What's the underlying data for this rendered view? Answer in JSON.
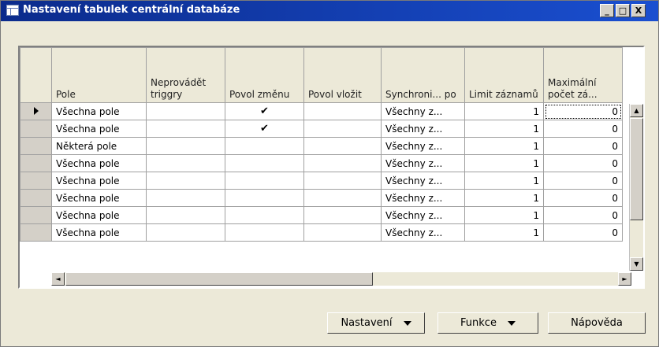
{
  "window": {
    "title": "Nastavení tabulek centrální databáze",
    "minimize": "_",
    "maximize": "□",
    "close": "X"
  },
  "grid": {
    "headers": [
      "Pole",
      "Neprovádět triggry",
      "Povol změnu",
      "Povol vložit",
      "Synchroni... po",
      "Limit záznamů",
      "Maximální počet zá..."
    ],
    "rows": [
      {
        "pole": "Všechna pole",
        "triggry": "",
        "zmenu": "✔",
        "vlozit": "",
        "sync": "Všechny z...",
        "limit": "1",
        "max": "0"
      },
      {
        "pole": "Všechna pole",
        "triggry": "",
        "zmenu": "✔",
        "vlozit": "",
        "sync": "Všechny z...",
        "limit": "1",
        "max": "0"
      },
      {
        "pole": "Některá pole",
        "triggry": "",
        "zmenu": "",
        "vlozit": "",
        "sync": "Všechny z...",
        "limit": "1",
        "max": "0"
      },
      {
        "pole": "Všechna pole",
        "triggry": "",
        "zmenu": "",
        "vlozit": "",
        "sync": "Všechny z...",
        "limit": "1",
        "max": "0"
      },
      {
        "pole": "Všechna pole",
        "triggry": "",
        "zmenu": "",
        "vlozit": "",
        "sync": "Všechny z...",
        "limit": "1",
        "max": "0"
      },
      {
        "pole": "Všechna pole",
        "triggry": "",
        "zmenu": "",
        "vlozit": "",
        "sync": "Všechny z...",
        "limit": "1",
        "max": "0"
      },
      {
        "pole": "Všechna pole",
        "triggry": "",
        "zmenu": "",
        "vlozit": "",
        "sync": "Všechny z...",
        "limit": "1",
        "max": "0"
      },
      {
        "pole": "Všechna pole",
        "triggry": "",
        "zmenu": "",
        "vlozit": "",
        "sync": "Všechny z...",
        "limit": "1",
        "max": "0"
      }
    ]
  },
  "buttons": {
    "nastaveni": "Nastavení",
    "funkce": "Funkce",
    "napoveda": "Nápověda"
  },
  "scroll": {
    "up": "▲",
    "down": "▼",
    "left": "◄",
    "right": "►"
  }
}
